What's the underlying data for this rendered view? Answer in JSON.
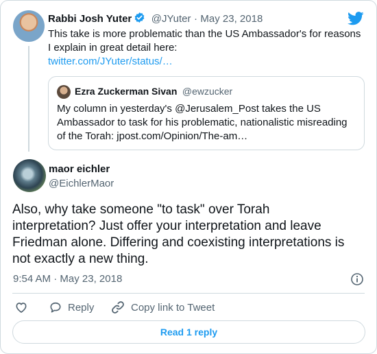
{
  "parent_tweet": {
    "author_name": "Rabbi Josh Yuter",
    "author_handle": "@JYuter",
    "separator": "·",
    "date": "May 23, 2018",
    "text_line1": "This take is more problematic than the US Ambassador's for reasons",
    "text_line2": "I explain in great detail here:",
    "link": "twitter.com/JYuter/status/…"
  },
  "quoted_tweet": {
    "author_name": "Ezra Zuckerman Sivan",
    "author_handle": "@ewzucker",
    "text_line1": "My column in yesterday's @Jerusalem_Post takes the US",
    "text_line2": "Ambassador to task for his problematic, nationalistic misreading",
    "text_line3": "of the Torah: jpost.com/Opinion/The-am…"
  },
  "main_tweet": {
    "author_name": "maor eichler",
    "author_handle": "@EichlerMaor",
    "text_line1": "Also, why take someone \"to task\" over Torah",
    "text_line2": "interpretation? Just offer your interpretation and leave",
    "text_line3": "Friedman alone. Differing and coexisting interpretations is",
    "text_line4": "not exactly a new thing.",
    "time": "9:54 AM",
    "separator": "·",
    "date": "May 23, 2018"
  },
  "actions": {
    "reply_label": "Reply",
    "copy_link_label": "Copy link to Tweet",
    "read_replies_label": "Read 1 reply"
  },
  "icons": {
    "like": "heart-icon",
    "reply": "speech-bubble-icon",
    "copy_link": "link-icon",
    "info": "info-icon",
    "brand": "twitter-bird-icon",
    "verified": "verified-badge-icon"
  },
  "colors": {
    "accent": "#1d9bf0",
    "text": "#0f1419",
    "secondary_text": "#536471",
    "border": "#cfd9de"
  }
}
